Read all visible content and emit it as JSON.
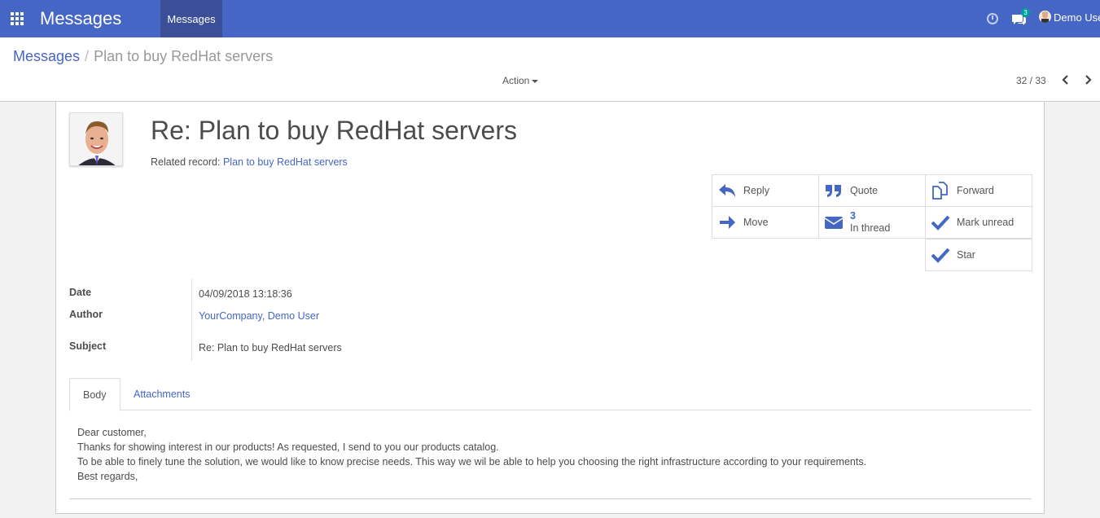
{
  "navbar": {
    "brand": "Messages",
    "menu_item": "Messages",
    "chat_count": "3",
    "user_name": "Demo User"
  },
  "breadcrumb": {
    "parent": "Messages",
    "separator": "/",
    "current": "Plan to buy RedHat servers"
  },
  "toolbar": {
    "action_label": "Action",
    "pager": "32 / 33"
  },
  "record": {
    "title": "Re: Plan to buy RedHat servers",
    "related_label": "Related record:",
    "related_value": "Plan to buy RedHat servers"
  },
  "buttons": {
    "reply": "Reply",
    "quote": "Quote",
    "forward": "Forward",
    "move": "Move",
    "thread_count": "3",
    "thread_label": "In thread",
    "mark_unread": "Mark unread",
    "star": "Star"
  },
  "fields": {
    "date_label": "Date",
    "date_value": "04/09/2018 13:18:36",
    "author_label": "Author",
    "author_value": "YourCompany, Demo User",
    "subject_label": "Subject",
    "subject_value": "Re: Plan to buy RedHat servers"
  },
  "tabs": {
    "body": "Body",
    "attachments": "Attachments"
  },
  "body": {
    "line1": "Dear customer,",
    "line2": "Thanks for showing interest in our products! As requested, I send to you our products catalog.",
    "line3": "To be able to finely tune the solution, we would like to know precise needs. This way we wil be able to help you choosing the right infrastructure according to your requirements.",
    "line4": "Best regards,"
  },
  "colors": {
    "navbar": "#4566c4",
    "active_menu": "#3a4f97",
    "link": "#4566c4",
    "badge": "#00a09d"
  }
}
